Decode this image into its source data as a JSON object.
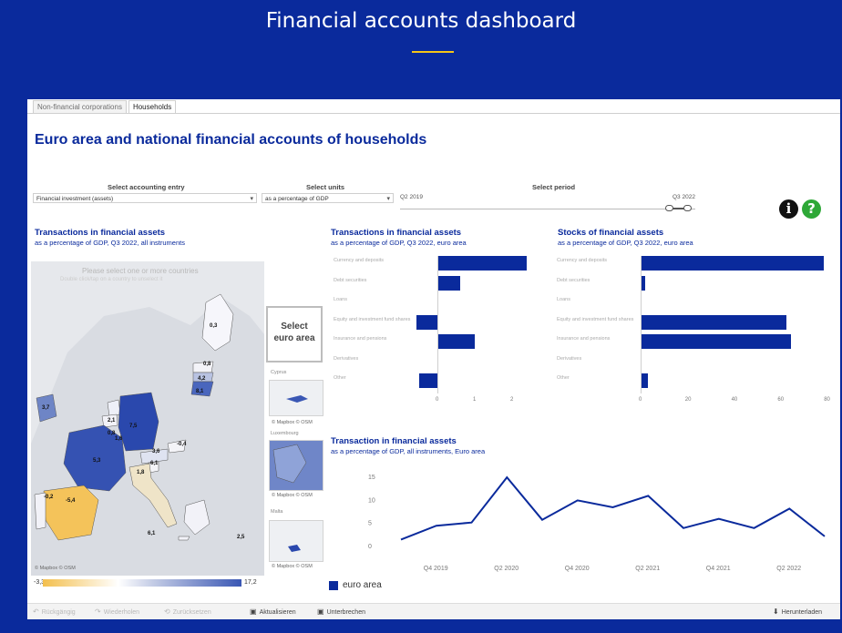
{
  "header": {
    "title": "Financial accounts dashboard",
    "accent_color": "#f5c518"
  },
  "tabs": [
    {
      "label": "Non-financial corporations",
      "active": false
    },
    {
      "label": "Households",
      "active": true
    }
  ],
  "main_title": "Euro area and national financial accounts of households",
  "controls": {
    "accounting_entry": {
      "label": "Select accounting entry",
      "value": "Financial investment (assets)"
    },
    "units": {
      "label": "Select units",
      "value": "as a percentage of GDP"
    },
    "period": {
      "label": "Select period",
      "start": "Q2 2019",
      "end": "Q3 2022"
    }
  },
  "icons": {
    "info": "i",
    "help": "?"
  },
  "map_panel": {
    "title": "Transactions in financial assets",
    "subtitle": "as a percentage of GDP, Q3 2022, all instruments",
    "hint": "Please select one or more countries",
    "hint_sub": "Double click/tap on a country to unselect it",
    "attribution": "© Mapbox  © OSM",
    "select_button": "Select\neuro area",
    "insets": [
      {
        "label": "Cyprus",
        "attribution": "© Mapbox  © OSM"
      },
      {
        "label": "Luxembourg",
        "attribution": "© Mapbox  © OSM"
      },
      {
        "label": "Malta",
        "attribution": "© Mapbox  © OSM"
      }
    ],
    "country_values": [
      "0,3",
      "0,8",
      "4,2",
      "8,1",
      "3,7",
      "2,1",
      "7,5",
      "0,8",
      "3,6",
      "1,6",
      "5,3",
      "-0,4",
      "1,8",
      "6,1",
      "6,1",
      "-0,2",
      "-5,4",
      "2,5"
    ],
    "legend_min": "-3,3",
    "legend_max": "17,2"
  },
  "chart_data": [
    {
      "type": "bar",
      "title": "Transactions in financial assets",
      "subtitle": "as a percentage of GDP, Q3 2022, euro area",
      "categories": [
        "Currency and deposits",
        "Debt securities",
        "Loans",
        "Equity and investment fund shares",
        "Insurance and pensions",
        "Derivatives",
        "Other"
      ],
      "values": [
        2.4,
        0.6,
        0.0,
        -0.55,
        1.0,
        0.0,
        -0.5
      ],
      "xticks": [
        "0",
        "1",
        "2"
      ]
    },
    {
      "type": "bar",
      "title": "Stocks of financial assets",
      "subtitle": "as a percentage of GDP, Q3 2022, euro area",
      "categories": [
        "Currency and deposits",
        "Debt securities",
        "Loans",
        "Equity and investment fund shares",
        "Insurance and pensions",
        "Derivatives",
        "Other"
      ],
      "values": [
        79,
        2,
        0,
        63,
        65,
        0,
        3
      ],
      "xticks": [
        "0",
        "20",
        "40",
        "60",
        "80"
      ]
    },
    {
      "type": "line",
      "title": "Transaction in financial assets",
      "subtitle": "as a percentage of GDP, all instruments, Euro area",
      "x": [
        "Q3 2019",
        "Q4 2019",
        "Q1 2020",
        "Q2 2020",
        "Q3 2020",
        "Q4 2020",
        "Q1 2021",
        "Q2 2021",
        "Q3 2021",
        "Q4 2021",
        "Q1 2022",
        "Q2 2022",
        "Q3 2022"
      ],
      "xticks": [
        "Q4 2019",
        "Q2 2020",
        "Q4 2020",
        "Q2 2021",
        "Q4 2021",
        "Q2 2022"
      ],
      "series": [
        {
          "name": "euro area",
          "values": [
            1.5,
            4.5,
            5.2,
            15.0,
            5.8,
            10.0,
            8.5,
            11.0,
            4.0,
            6.0,
            4.0,
            8.2,
            2.2
          ]
        }
      ],
      "yticks": [
        "0",
        "5",
        "10",
        "15"
      ],
      "ylim": [
        0,
        17
      ]
    }
  ],
  "footer": {
    "items": [
      {
        "label": "Rückgängig",
        "enabled": false
      },
      {
        "label": "Wiederholen",
        "enabled": false
      },
      {
        "label": "Zurücksetzen",
        "enabled": false
      },
      {
        "label": "Aktualisieren",
        "enabled": true
      },
      {
        "label": "Unterbrechen",
        "enabled": true
      }
    ],
    "download": "Herunterladen"
  }
}
